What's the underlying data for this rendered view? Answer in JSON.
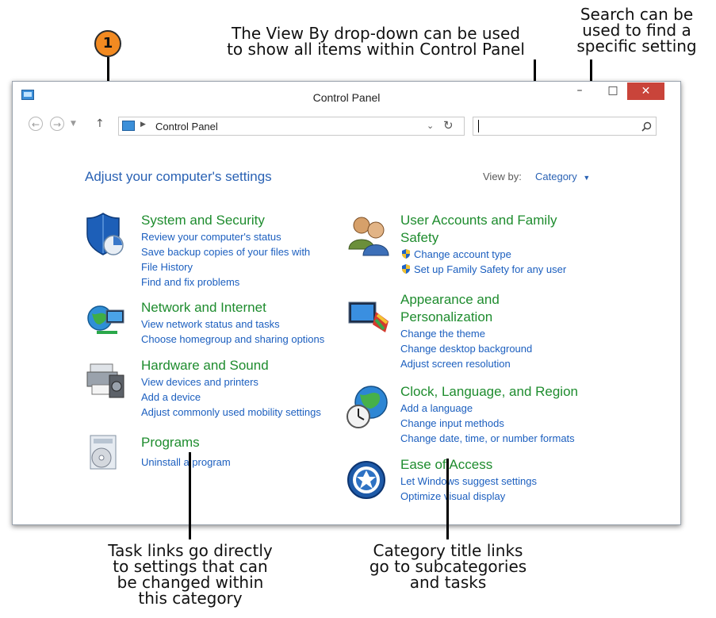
{
  "callouts": {
    "badge": "1",
    "viewby": [
      "The View By drop-down can be used",
      "to show all items within Control Panel"
    ],
    "search": [
      "Search can be",
      "used to find a",
      "specific setting"
    ],
    "tasklinks": [
      "Task links go directly",
      "to settings that can",
      "be changed within",
      "this category"
    ],
    "categorytitles": [
      "Category title links",
      "go to subcategories",
      "and tasks"
    ]
  },
  "window": {
    "title": "Control Panel",
    "address": "Control Panel",
    "search_value": ""
  },
  "content": {
    "heading": "Adjust your computer's settings",
    "view_by_label": "View by:",
    "view_by_value": "Category"
  },
  "categories_left": [
    {
      "title": "System and Security",
      "links": [
        "Review your computer's status",
        "Save backup copies of your files with",
        "File History",
        "Find and fix problems"
      ]
    },
    {
      "title": "Network and Internet",
      "links": [
        "View network status and tasks",
        "Choose homegroup and sharing options"
      ]
    },
    {
      "title": "Hardware and Sound",
      "links": [
        "View devices and printers",
        "Add a device",
        "Adjust commonly used mobility settings"
      ]
    },
    {
      "title": "Programs",
      "links": [
        "Uninstall a program"
      ]
    }
  ],
  "categories_right": [
    {
      "title_lines": [
        "User Accounts and Family",
        "Safety"
      ],
      "links": [
        "Change account type",
        "Set up Family Safety for any user"
      ]
    },
    {
      "title_lines": [
        "Appearance and",
        "Personalization"
      ],
      "links": [
        "Change the theme",
        "Change desktop background",
        "Adjust screen resolution"
      ]
    },
    {
      "title_lines": [
        "Clock, Language, and Region"
      ],
      "links": [
        "Add a language",
        "Change input methods",
        "Change date, time, or number formats"
      ]
    },
    {
      "title_lines": [
        "Ease of Access"
      ],
      "links": [
        "Let Windows suggest settings",
        "Optimize visual display"
      ]
    }
  ],
  "icons": {
    "app": "control-panel-icon",
    "system_security": "shield-icon",
    "network": "globe-network-icon",
    "hardware": "printer-icon",
    "programs": "programs-icon",
    "user_accounts": "users-icon",
    "appearance": "monitor-paint-icon",
    "clock": "globe-clock-icon",
    "ease": "ease-of-access-icon"
  },
  "colors": {
    "category_title": "#1e8c2e",
    "link": "#1c5fbf",
    "heading": "#2a62b4",
    "close_button": "#c9443a",
    "badge": "#f28a21"
  }
}
